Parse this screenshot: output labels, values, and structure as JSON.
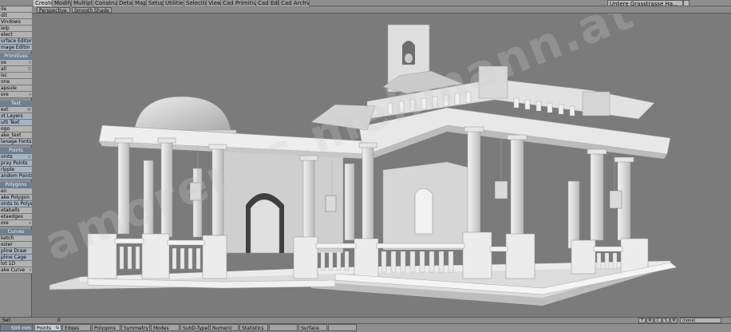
{
  "top_tabs": [
    {
      "label": "Create",
      "active": true
    },
    {
      "label": "Modify"
    },
    {
      "label": "Multiply"
    },
    {
      "label": "Construct"
    },
    {
      "label": "Detail"
    },
    {
      "label": "Map"
    },
    {
      "label": "Setup"
    },
    {
      "label": "Utilities"
    },
    {
      "label": "Selection"
    },
    {
      "label": "View"
    },
    {
      "label": "Cad Primitives"
    },
    {
      "label": "Cad Edit"
    },
    {
      "label": "Cad ArchViz"
    }
  ],
  "top_right_field": "Untere Grasstrasse Ha...",
  "viewport_header": {
    "view_mode": "Perspective",
    "shade_mode": "Smooth Shade"
  },
  "sidebar": {
    "file_items": [
      "ile",
      "dit",
      "Vindows",
      "lelp",
      "elect"
    ],
    "editors": [
      "urface Editor",
      "mage Editor"
    ],
    "primitives_header": "Primitives",
    "primitives": [
      {
        "label": "ox",
        "key": "X"
      },
      {
        "label": "all",
        "key": "O"
      },
      {
        "label": "isc",
        "key": ""
      },
      {
        "label": "one",
        "key": ""
      },
      {
        "label": "apsule",
        "key": ""
      },
      {
        "label": "ore",
        "key": ""
      }
    ],
    "text_header": "Text",
    "text_items": [
      {
        "label": "ext",
        "key": "W"
      },
      {
        "label": "xt Layers",
        "key": ""
      },
      {
        "label": "ulti Text",
        "key": ""
      },
      {
        "label": "ogo",
        "key": ""
      },
      {
        "label": "ake_text",
        "key": ""
      },
      {
        "label": "lanage Fonts",
        "key": ""
      }
    ],
    "points_header": "Points",
    "points_items": [
      {
        "label": "oints",
        "key": "+"
      },
      {
        "label": "pray Points",
        "key": ""
      },
      {
        "label": "ripple",
        "key": ""
      },
      {
        "label": "andom Points",
        "key": ""
      }
    ],
    "polygons_header": "Polygons",
    "polygons_items": [
      "en",
      "ake Polygon",
      "oints to Polys",
      "etaballs",
      "etaedges",
      "ore"
    ],
    "curves_header": "Curves",
    "curves_items": [
      "ketch",
      "ezier",
      "pline Draw",
      "pline Cage",
      "lot 1D",
      "ake Curve"
    ]
  },
  "watermark": "amoreuss.mehmann.at",
  "status_bar": {
    "sel_label": "Sel:",
    "sel_value": "0",
    "icons": [
      "T",
      "M",
      "C",
      "S",
      "M"
    ],
    "layer": "(none)"
  },
  "bottom_bar": {
    "grid_size": "500 mm",
    "buttons": [
      "Points",
      "Edges",
      "Polygons",
      "Symmetry",
      "Modes",
      "SubD-Type",
      "Numeric",
      "Statistics",
      "",
      "Surface",
      ""
    ],
    "points_key": "G"
  },
  "colors": {
    "background": "#7b7b7b",
    "panel": "#8e8e8e",
    "accent_blue": "#6f7f92",
    "active_tab": "#c9c9c9",
    "model": "#e5e5e5"
  }
}
